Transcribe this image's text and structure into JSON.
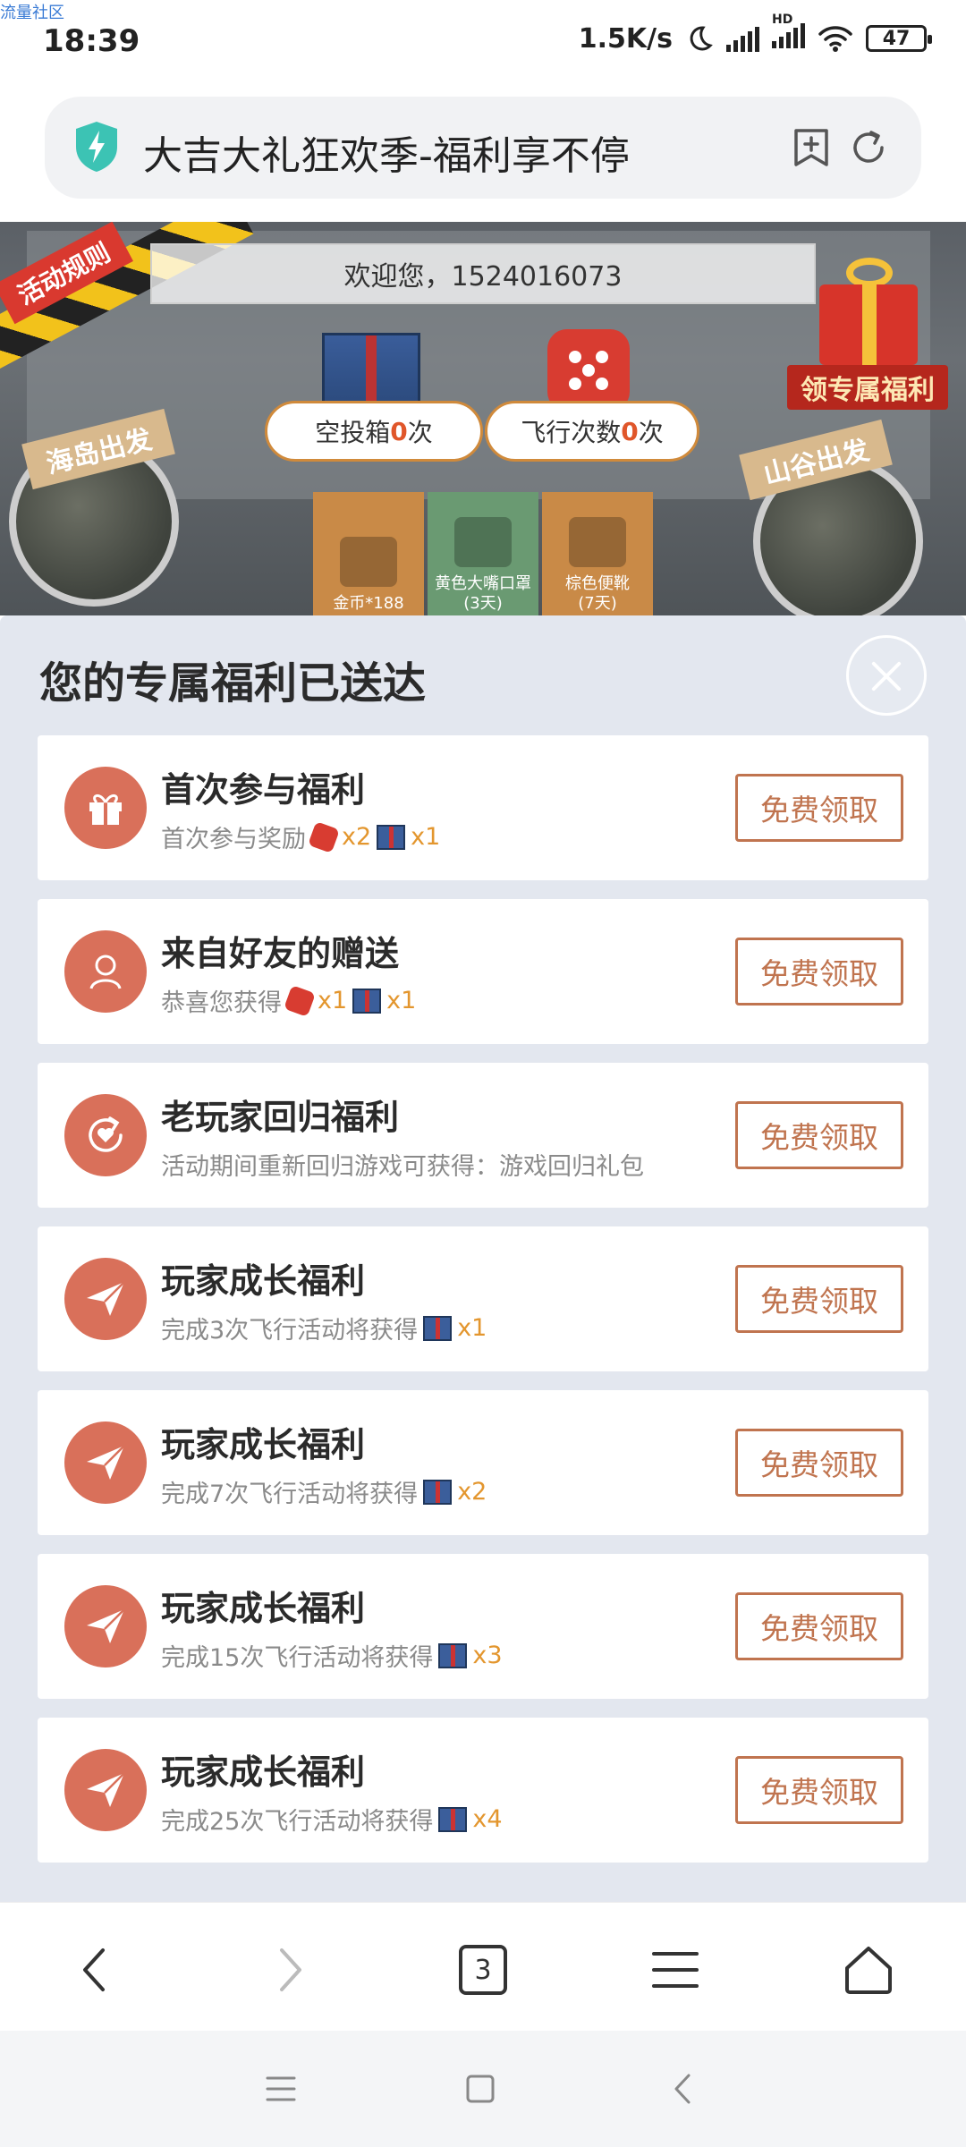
{
  "status_bar": {
    "watermark": "流量社区",
    "time": "18:39",
    "net_speed": "1.5K/s",
    "hd_label": "HD",
    "battery": "47"
  },
  "url_bar": {
    "title": "大吉大礼狂欢季-福利享不停",
    "icons": [
      "shield-bolt-icon",
      "bookmark-add-icon",
      "refresh-icon"
    ]
  },
  "banner": {
    "rules_tag": "活动规则",
    "welcome": "欢迎您，1524016073",
    "airdrop": {
      "label": "空投箱",
      "count": "0",
      "unit": "次"
    },
    "flight": {
      "label": "飞行次数",
      "count": "0",
      "unit": "次"
    },
    "exclusive_tag": "领专属福利",
    "island_tag": "海岛出发",
    "valley_tag": "山谷出发",
    "rewards": [
      {
        "line1": "金币*188",
        "line2": ""
      },
      {
        "line1": "黄色大嘴口罩",
        "line2": "(3天)"
      },
      {
        "line1": "棕色便靴",
        "line2": "(7天)"
      }
    ]
  },
  "sheet": {
    "title": "您的专属福利已送达",
    "claim_label": "免费领取",
    "cards": [
      {
        "title": "首次参与福利",
        "desc": "首次参与奖励",
        "icon": "gift-icon",
        "items": [
          {
            "type": "dice",
            "qty": "x2"
          },
          {
            "type": "crate",
            "qty": "x1"
          }
        ]
      },
      {
        "title": "来自好友的赠送",
        "desc": "恭喜您获得",
        "icon": "friend-icon",
        "items": [
          {
            "type": "dice",
            "qty": "x1"
          },
          {
            "type": "crate",
            "qty": "x1"
          }
        ]
      },
      {
        "title": "老玩家回归福利",
        "desc": "活动期间重新回归游戏可获得：游戏回归礼包",
        "icon": "return-icon",
        "items": []
      },
      {
        "title": "玩家成长福利",
        "desc": "完成3次飞行活动将获得",
        "icon": "paper-plane-icon",
        "items": [
          {
            "type": "crate",
            "qty": "x1"
          }
        ]
      },
      {
        "title": "玩家成长福利",
        "desc": "完成7次飞行活动将获得",
        "icon": "paper-plane-icon",
        "items": [
          {
            "type": "crate",
            "qty": "x2"
          }
        ]
      },
      {
        "title": "玩家成长福利",
        "desc": "完成15次飞行活动将获得",
        "icon": "paper-plane-icon",
        "items": [
          {
            "type": "crate",
            "qty": "x3"
          }
        ]
      },
      {
        "title": "玩家成长福利",
        "desc": "完成25次飞行活动将获得",
        "icon": "paper-plane-icon",
        "items": [
          {
            "type": "crate",
            "qty": "x4"
          }
        ]
      }
    ]
  },
  "browser_nav": {
    "tab_count": "3",
    "icons": [
      "back-icon",
      "forward-icon",
      "tabs-icon",
      "menu-icon",
      "home-icon"
    ]
  },
  "system_nav": {
    "icons": [
      "recents-icon",
      "home-square-icon",
      "system-back-icon"
    ]
  },
  "colors": {
    "accent": "#c0744f",
    "icon_bg": "#d9705a",
    "qty": "#e3962e",
    "sheet_bg": "#e3e7ef"
  }
}
